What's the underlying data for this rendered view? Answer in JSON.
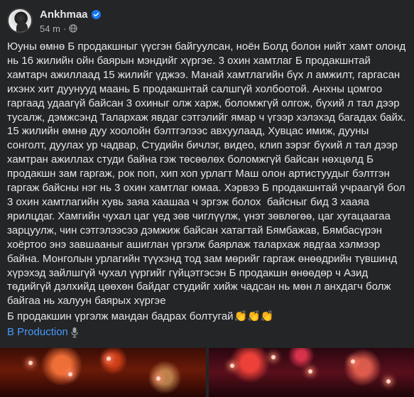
{
  "post": {
    "author": "Ankhmaa",
    "time": "54 m",
    "separator": "·",
    "body": "Юуны өмнө Б продакшныг үүсгэн байгуулсан, ноён Болд болон нийт хамт олонд нь 16 жилийн ойн баярын мэндийг хүргэе. 3 охин хамтлаг Б продакшнтай хамтарч ажиллаад 15 жилийг үджээ. Манай хамтлагийн бүх л амжилт, гаргасан ихэнх хит дуунууд маань Б продакшнтай салшгүй холбоотой. Анхны цомгоо гаргаад удаагүй байсан 3 охиныг олж харж, боломжгүй олгож, бүхий л тал дээр тусалж, дэмжсэнд Талархаж явдаг сэтгэлийг ямар ч үгээр хэлэхэд багадах байх. 15 жилийн өмнө дуу хоолойн бэлтгэлээс авхуулаад, Хувцас имиж, дууны сонголт, дуулах ур чадвар, Студийн бичлэг, видео, клип зэрэг бүхий л тал дээр хамтран ажиллах студи байна гэж төсөөлөх боломжгүй байсан нөхцөлд Б продакшн зам гаргаж, рок поп, хип хоп урлагт Маш олон артистуудыг бэлтгэн гаргаж байсны нэг нь 3 охин хамтлаг юмаа. Хэрвээ Б продакшнтай учраагүй бол 3 охин хамтлагийн хувь заяа хаашаа ч эргэж болох  байсныг бид 3 хааяа ярилцдаг. Хамгийн чухал цаг үед зөв чиглүүлж, үнэт зөвлөгөө, цаг хугацаагаа зарцуулж, чин сэтгэлээсээ дэмжиж байсан хатагтай Бямбажав, Бямбасүрэн хоёртоо энэ завшааныг ашиглан үргэлж баярлаж талархаж явдгаа хэлмээр байна. Монголын урлагийн түүхэнд тод зам мөрийг гаргаж өнөөдрийн түвшинд хүрэхэд зайлшгүй чухал үүргийг гүйцэтгэсэн Б продакшн өнөөдөр ч Азид төдийгүй дэлхийд цөөхөн байдаг студийг хийж чадсан нь мөн л анхдагч болж байгаа нь халуун баярых хүргэе",
    "closing": "Б продакшин үргэлж мандан бадрах болтугай",
    "claps": "👏👏👏",
    "hashtag": "B Production",
    "icons": {
      "verified": "verified-badge-icon",
      "audience": "globe-icon",
      "hashtag_emoji": "microphone-icon"
    },
    "colors": {
      "background": "#242526",
      "text": "#e4e6eb",
      "secondary": "#b0b3b8",
      "link": "#4599ff",
      "verified": "#1877f2"
    }
  }
}
